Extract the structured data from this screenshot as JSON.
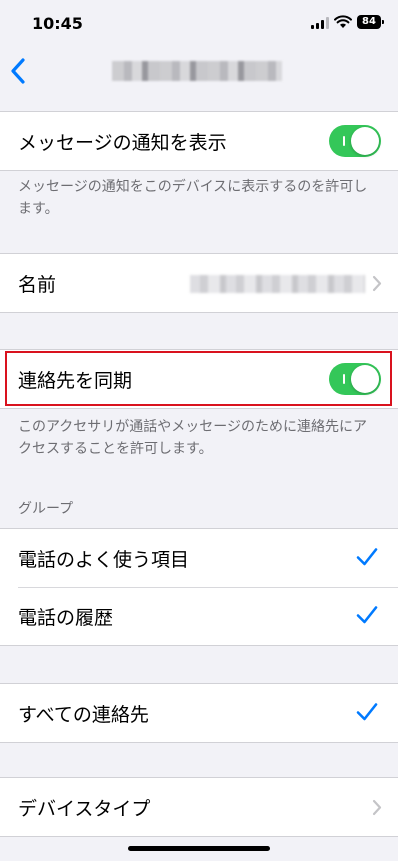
{
  "status_bar": {
    "time": "10:45",
    "battery": "84"
  },
  "nav": {
    "back_icon": "chevron-left-icon"
  },
  "notifications": {
    "label": "メッセージの通知を表示",
    "enabled": true,
    "footer": "メッセージの通知をこのデバイスに表示するのを許可します。"
  },
  "name_row": {
    "label": "名前"
  },
  "sync_contacts": {
    "label": "連絡先を同期",
    "enabled": true,
    "footer": "このアクセサリが通話やメッセージのために連絡先にアクセスすることを許可します。"
  },
  "groups": {
    "header": "グループ",
    "items": [
      {
        "label": "電話のよく使う項目",
        "checked": true
      },
      {
        "label": "電話の履歴",
        "checked": true
      }
    ]
  },
  "all_contacts": {
    "label": "すべての連絡先",
    "checked": true
  },
  "device_type": {
    "label": "デバイスタイプ"
  },
  "colors": {
    "accent": "#007aff",
    "toggle_on": "#34c759",
    "highlight": "#d9121e"
  }
}
